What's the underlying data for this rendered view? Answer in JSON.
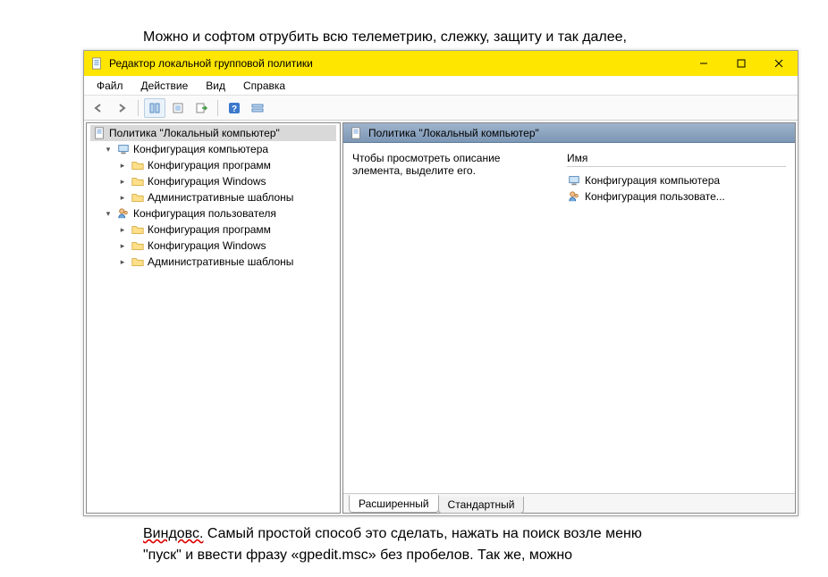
{
  "background": {
    "top_text": "Можно и софтом отрубить всю телеметрию, слежку, защиту и так далее,",
    "bottom_text_1a": "Виндовс.",
    "bottom_text_1b": " Самый простой способ это сделать, нажать на поиск возле меню",
    "bottom_text_2": "\"пуск\" и ввести фразу «gpedit.msc» без пробелов. Так же, можно"
  },
  "window": {
    "title": "Редактор локальной групповой политики"
  },
  "menu": {
    "file": "Файл",
    "action": "Действие",
    "view": "Вид",
    "help": "Справка"
  },
  "tree": {
    "root": "Политика \"Локальный компьютер\"",
    "comp_config": "Конфигурация компьютера",
    "prog_config": "Конфигурация программ",
    "win_config": "Конфигурация Windows",
    "admin_templates": "Административные шаблоны",
    "user_config": "Конфигурация пользователя"
  },
  "right": {
    "header": "Политика \"Локальный компьютер\"",
    "description": "Чтобы просмотреть описание элемента, выделите его.",
    "col_name": "Имя",
    "items": {
      "comp": "Конфигурация компьютера",
      "user": "Конфигурация пользовате..."
    },
    "tabs": {
      "extended": "Расширенный",
      "standard": "Стандартный"
    }
  }
}
